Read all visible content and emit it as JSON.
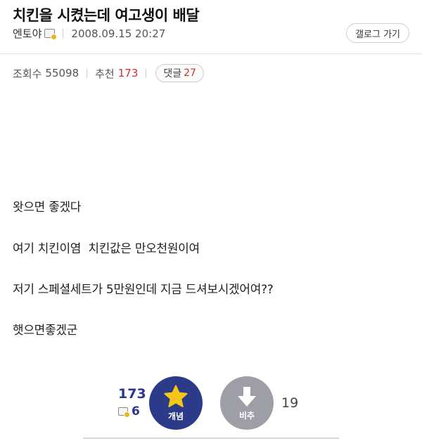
{
  "post": {
    "title": "치킨을 시켰는데 여고생이 배달",
    "author": "엔토야",
    "date": "2008.09.15 20:27",
    "back_button": "갤로그 가기",
    "views_label": "조회수",
    "views": "55098",
    "recommend_label": "추천",
    "recommend": "173",
    "comments_label": "댓글",
    "comments": "27"
  },
  "body": {
    "lines": [
      "왓으면 좋겠다",
      "여기 치킨이염  치킨값은 만오천원이여",
      "저기 스페셜세트가 5만원인데 지금 드셔보시겠어여??",
      "햇으면좋겠군"
    ]
  },
  "votes": {
    "up_count": "173",
    "fixed_count": "6",
    "up_label": "개념",
    "down_label": "비추",
    "down_count": "19"
  },
  "colors": {
    "accent_navy": "#2c3a8a",
    "red": "#d0312d",
    "star": "#f5c518",
    "gray_circle": "#9e9ea6"
  }
}
